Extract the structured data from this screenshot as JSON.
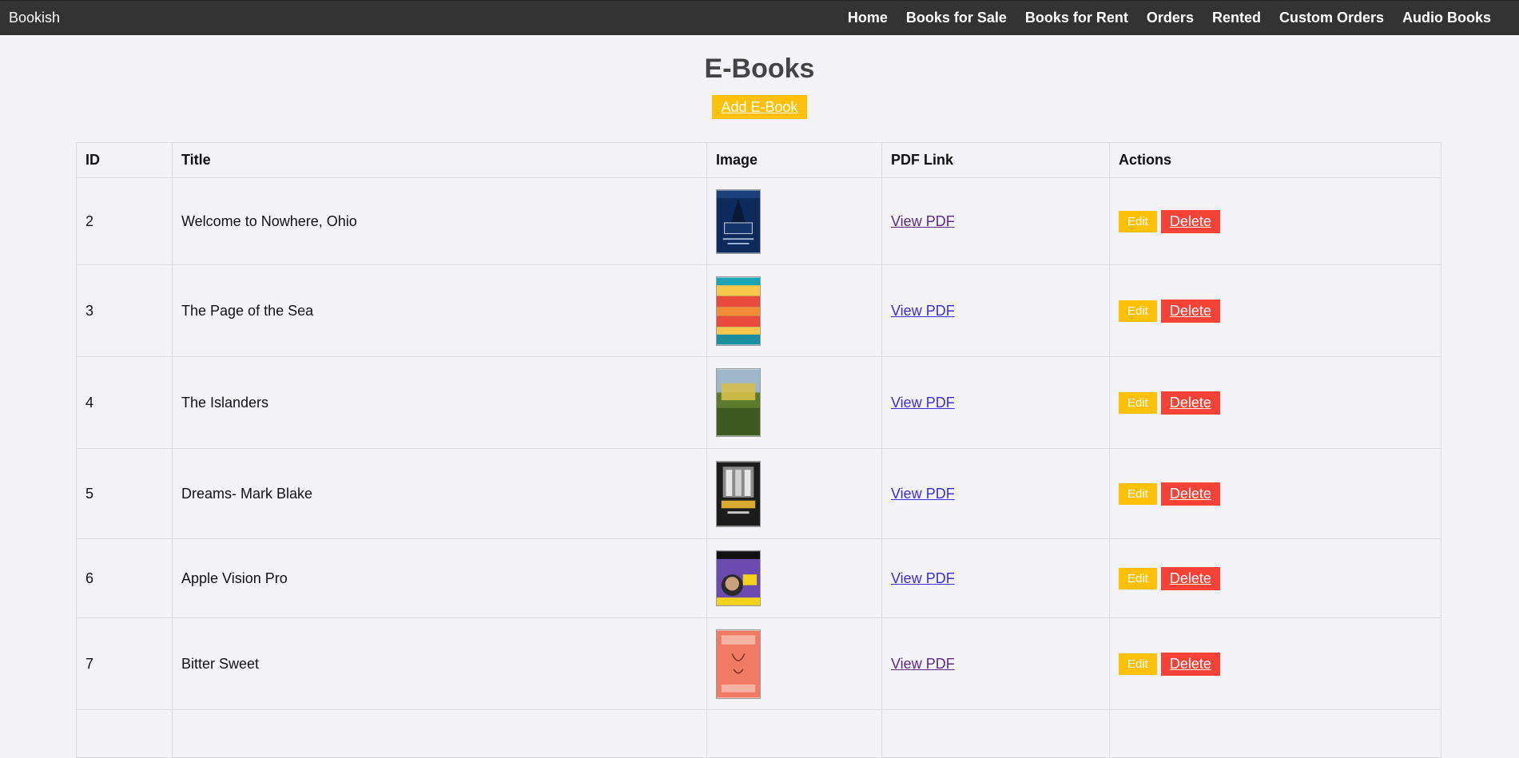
{
  "nav": {
    "brand": "Bookish",
    "links": [
      "Home",
      "Books for Sale",
      "Books for Rent",
      "Orders",
      "Rented",
      "Custom Orders",
      "Audio Books"
    ]
  },
  "page": {
    "title": "E-Books",
    "add_label": "Add E-Book"
  },
  "table": {
    "headers": [
      "ID",
      "Title",
      "Image",
      "PDF Link",
      "Actions"
    ],
    "rows": [
      {
        "id": "2",
        "title": "Welcome to Nowhere, Ohio",
        "pdf": "View PDF",
        "edit": "Edit",
        "delete": "Delete"
      },
      {
        "id": "3",
        "title": "The Page of the Sea",
        "pdf": "View PDF",
        "edit": "Edit",
        "delete": "Delete"
      },
      {
        "id": "4",
        "title": "The Islanders",
        "pdf": "View PDF",
        "edit": "Edit",
        "delete": "Delete"
      },
      {
        "id": "5",
        "title": "Dreams- Mark Blake",
        "pdf": "View PDF",
        "edit": "Edit",
        "delete": "Delete"
      },
      {
        "id": "6",
        "title": "Apple Vision Pro",
        "pdf": "View PDF",
        "edit": "Edit",
        "delete": "Delete"
      },
      {
        "id": "7",
        "title": "Bitter Sweet",
        "pdf": "View PDF",
        "edit": "Edit",
        "delete": "Delete"
      }
    ]
  },
  "colors": {
    "navbar": "#333333",
    "accent_yellow": "#ffc107",
    "danger_red": "#f44336",
    "link_blue": "#3b2fd6",
    "link_visited": "#5a2a86"
  }
}
